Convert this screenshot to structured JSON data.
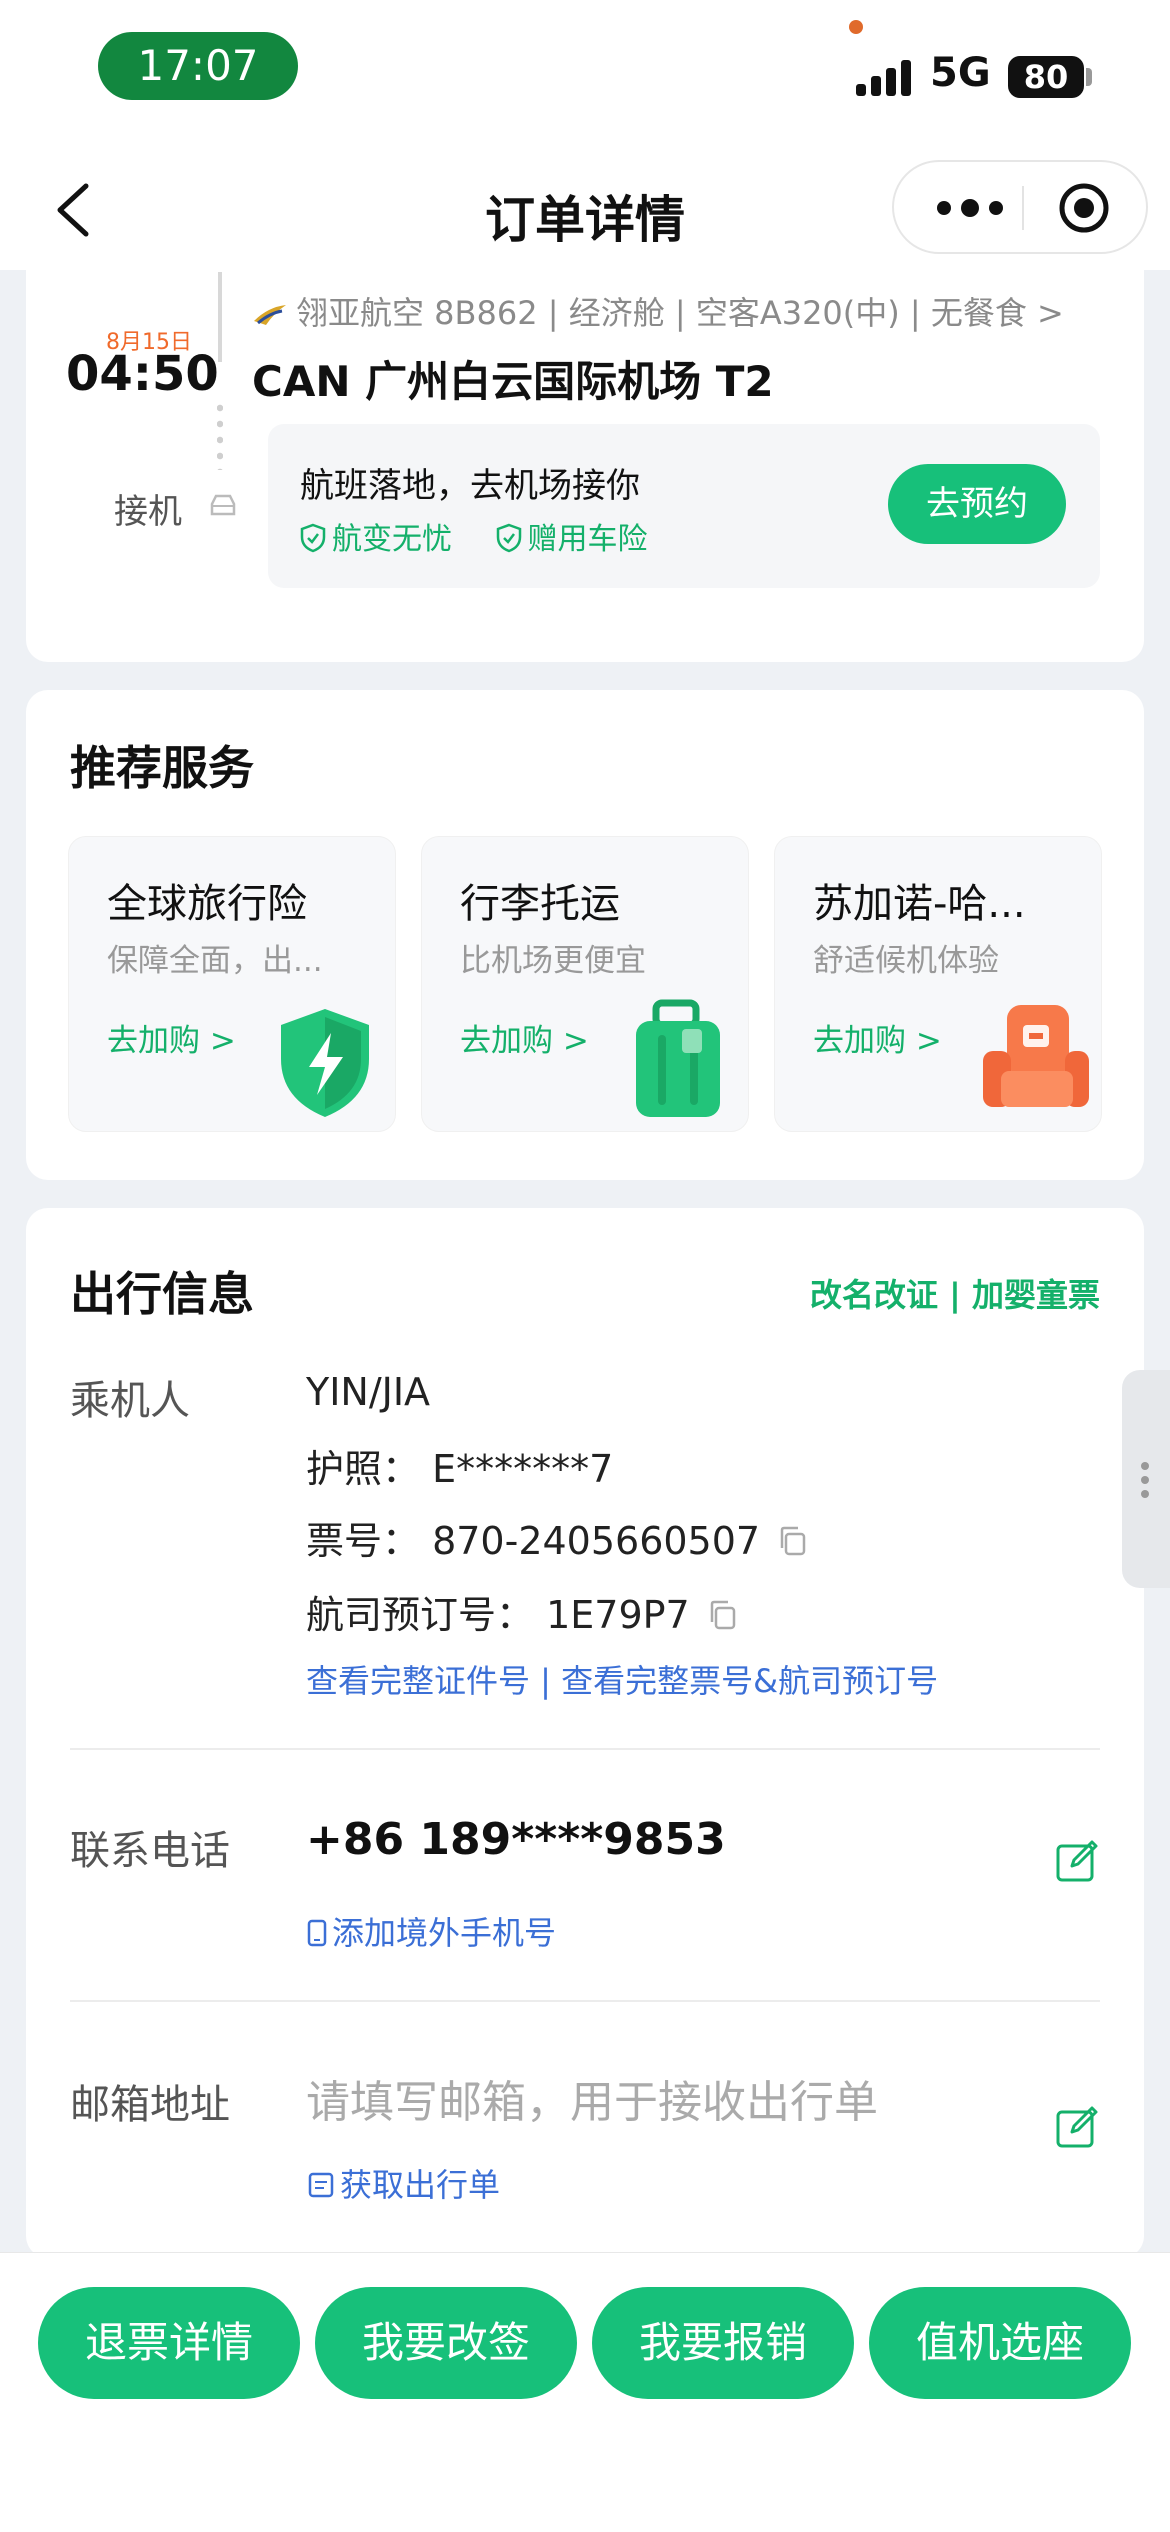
{
  "status_bar": {
    "time": "17:07",
    "network": "5G",
    "battery": "80"
  },
  "nav": {
    "title": "订单详情"
  },
  "flight": {
    "date": "8月15日",
    "time": "04:50",
    "airline_info": "翎亚航空 8B862 | 经济舱 | 空客A320(中) | 无餐食 >",
    "airport": "CAN 广州白云国际机场 T2",
    "pickup_label": "接机",
    "pickup_title": "航班落地，去机场接你",
    "pickup_tags": [
      "航变无忧",
      "赠用车险"
    ],
    "reserve_button": "去预约"
  },
  "recommend": {
    "title": "推荐服务",
    "items": [
      {
        "title": "全球旅行险",
        "subtitle": "保障全面，出...",
        "link": "去加购 >"
      },
      {
        "title": "行李托运",
        "subtitle": "比机场更便宜",
        "link": "去加购 >"
      },
      {
        "title": "苏加诺-哈...",
        "subtitle": "舒适候机体验",
        "link": "去加购 >"
      }
    ]
  },
  "travel_info": {
    "title": "出行信息",
    "links": "改名改证 | 加婴童票",
    "passenger_label": "乘机人",
    "passenger_name": "YIN/JIA",
    "passport": "护照：  E*******7",
    "ticket_no": "票号：  870-2405660507",
    "pnr": "航司预订号：  1E79P7",
    "view_links": "查看完整证件号 | 查看完整票号&航司预订号",
    "phone_label": "联系电话",
    "phone": "+86 189****9853",
    "add_phone": "添加境外手机号",
    "email_label": "邮箱地址",
    "email_placeholder": "请填写邮箱，用于接收出行单",
    "get_itinerary": "获取出行单"
  },
  "bottom_buttons": [
    "退票详情",
    "我要改签",
    "我要报销",
    "值机选座"
  ],
  "colors": {
    "accent": "#17c07a",
    "date_orange": "#f06a2b",
    "link_blue": "#3b6fd6"
  }
}
